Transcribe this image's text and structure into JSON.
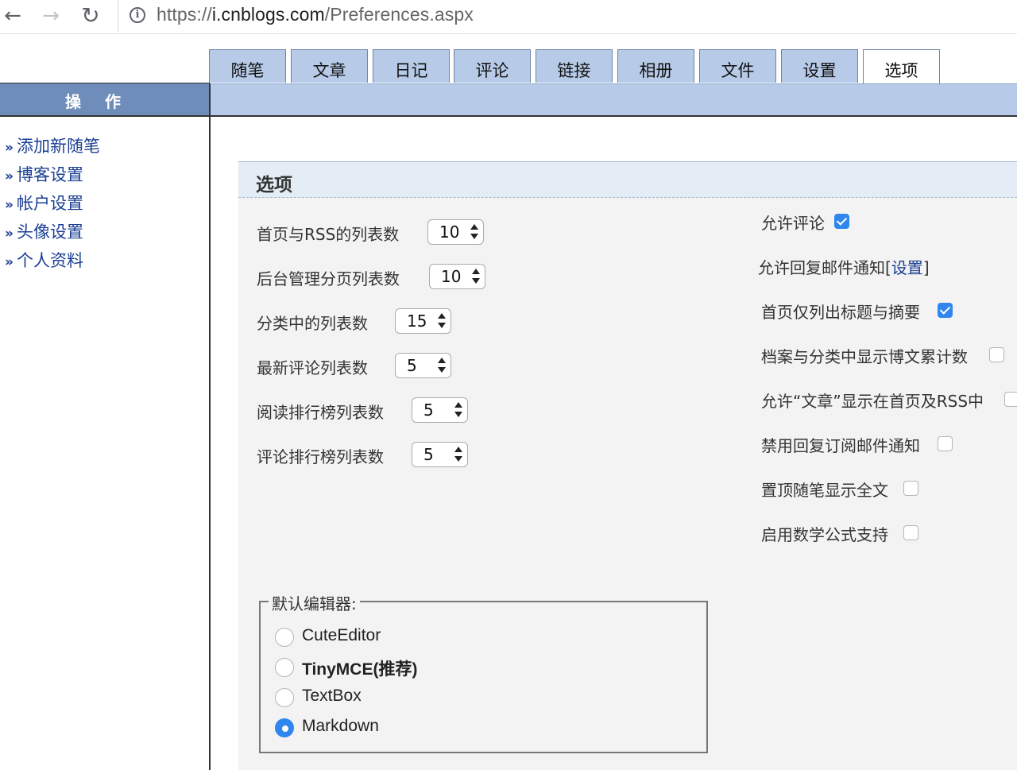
{
  "browser": {
    "url_scheme": "https://",
    "url_host": "i.cnblogs.com",
    "url_path": "/Preferences.aspx"
  },
  "tabs": [
    {
      "label": "随笔",
      "active": false
    },
    {
      "label": "文章",
      "active": false
    },
    {
      "label": "日记",
      "active": false
    },
    {
      "label": "评论",
      "active": false
    },
    {
      "label": "链接",
      "active": false
    },
    {
      "label": "相册",
      "active": false
    },
    {
      "label": "文件",
      "active": false
    },
    {
      "label": "设置",
      "active": false
    },
    {
      "label": "选项",
      "active": true
    }
  ],
  "sidebar": {
    "header": "操作",
    "bullet": "»",
    "links": [
      "添加新随笔",
      "博客设置",
      "帐户设置",
      "头像设置",
      "个人资料"
    ]
  },
  "panel": {
    "title": "选项",
    "selects": [
      {
        "label": "首页与RSS的列表数",
        "value": "10"
      },
      {
        "label": "后台管理分页列表数",
        "value": "10"
      },
      {
        "label": "分类中的列表数",
        "value": "15"
      },
      {
        "label": "最新评论列表数",
        "value": "5"
      },
      {
        "label": "阅读排行榜列表数",
        "value": "5"
      },
      {
        "label": "评论排行榜列表数",
        "value": "5"
      }
    ],
    "checks": [
      {
        "label": "允许评论",
        "checked": true
      },
      {
        "label": "允许回复邮件通知",
        "link_open": "[",
        "link": "设置",
        "link_close": "]"
      },
      {
        "label": "首页仅列出标题与摘要",
        "checked": true
      },
      {
        "label": "档案与分类中显示博文累计数",
        "checked": false
      },
      {
        "label": "允许“文章”显示在首页及RSS中",
        "checked": false
      },
      {
        "label": "禁用回复订阅邮件通知",
        "checked": false
      },
      {
        "label": "置顶随笔显示全文",
        "checked": false
      },
      {
        "label": "启用数学公式支持",
        "checked": false
      }
    ],
    "editor": {
      "legend": "默认编辑器:",
      "options": [
        {
          "label": "CuteEditor",
          "selected": false
        },
        {
          "label": "TinyMCE(推荐)",
          "selected": false
        },
        {
          "label": "TextBox",
          "selected": false
        },
        {
          "label": "Markdown",
          "selected": true
        }
      ]
    }
  }
}
